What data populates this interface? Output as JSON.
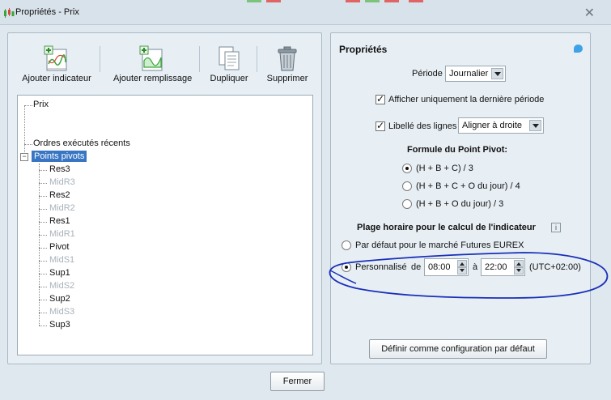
{
  "window": {
    "title": "Propriétés - Prix",
    "close_glyph": "✕"
  },
  "toolbar": {
    "add_indicator": "Ajouter indicateur",
    "add_fill": "Ajouter remplissage",
    "duplicate": "Dupliquer",
    "delete": "Supprimer"
  },
  "tree": {
    "items": [
      {
        "label": "Prix"
      },
      {
        "label": "Ordres exécutés récents"
      },
      {
        "label": "Points pivots"
      },
      {
        "label": "Res3"
      },
      {
        "label": "MidR3"
      },
      {
        "label": "Res2"
      },
      {
        "label": "MidR2"
      },
      {
        "label": "Res1"
      },
      {
        "label": "MidR1"
      },
      {
        "label": "Pivot"
      },
      {
        "label": "MidS1"
      },
      {
        "label": "Sup1"
      },
      {
        "label": "MidS2"
      },
      {
        "label": "Sup2"
      },
      {
        "label": "MidS3"
      },
      {
        "label": "Sup3"
      }
    ]
  },
  "props": {
    "title": "Propriétés",
    "period_label": "Période",
    "period_value": "Journalier",
    "only_last_period": "Afficher uniquement la dernière période",
    "line_labels": "Libellé des lignes",
    "line_labels_value": "Aligner à droite",
    "formula_title": "Formule du Point Pivot:",
    "formulas": [
      "(H + B + C) / 3",
      "(H + B + C + O du jour) / 4",
      "(H + B + O du jour) / 3"
    ],
    "range_title": "Plage horaire pour le calcul de l'indicateur",
    "info_glyph": "i",
    "default_range": "Par défaut pour le marché Futures EUREX",
    "custom_range": "Personnalisé",
    "from_label": "de",
    "from_value": "08:00",
    "to_label": "à",
    "to_value": "22:00",
    "tz": "(UTC+02:00)",
    "set_default_button": "Définir comme configuration par défaut"
  },
  "footer": {
    "close_button": "Fermer"
  },
  "colors": {
    "selection": "#3876c4",
    "annotation_ink": "#1a2fb8",
    "info_bubble": "#3da2e6"
  }
}
